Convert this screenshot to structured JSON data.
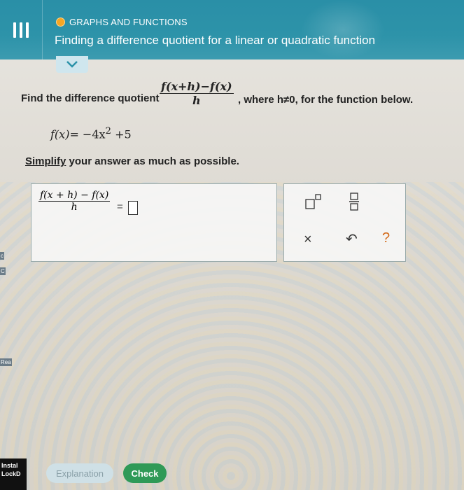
{
  "header": {
    "menu_icon": "menu-icon",
    "topic": "GRAPHS AND FUNCTIONS",
    "lesson_title": "Finding a difference quotient for a linear or quadratic function",
    "collapse_icon": "chevron-down-icon"
  },
  "problem": {
    "intro": "Find the difference quotient",
    "fraction_numerator": "f(x+h)−f(x)",
    "fraction_denominator": "h",
    "condition": ", where h≠0, for the function below."
  },
  "function": {
    "lhs": "f(x)",
    "rhs_part1": "= −4x",
    "exponent": "2",
    "rhs_part2": " +5"
  },
  "instruction": {
    "link": "Simplify",
    "rest": " your answer as much as possible."
  },
  "answer": {
    "numerator": "f(x + h) − f(x)",
    "denominator": "h",
    "equals": "=",
    "value": ""
  },
  "tools": {
    "exponent": "exponent-icon",
    "fraction": "fraction-icon",
    "clear": "×",
    "undo": "↶",
    "help": "?"
  },
  "side_strip": {
    "items": [
      "c",
      "C",
      "Rea"
    ]
  },
  "bottom_left": {
    "line1": "Instal",
    "line2": "LockD"
  },
  "buttons": {
    "explanation": "Explanation",
    "check": "Check"
  },
  "colors": {
    "header": "#2d93a9",
    "topic_dot": "#f5a623",
    "check_button": "#2f9a57",
    "help": "#d36a1a"
  }
}
